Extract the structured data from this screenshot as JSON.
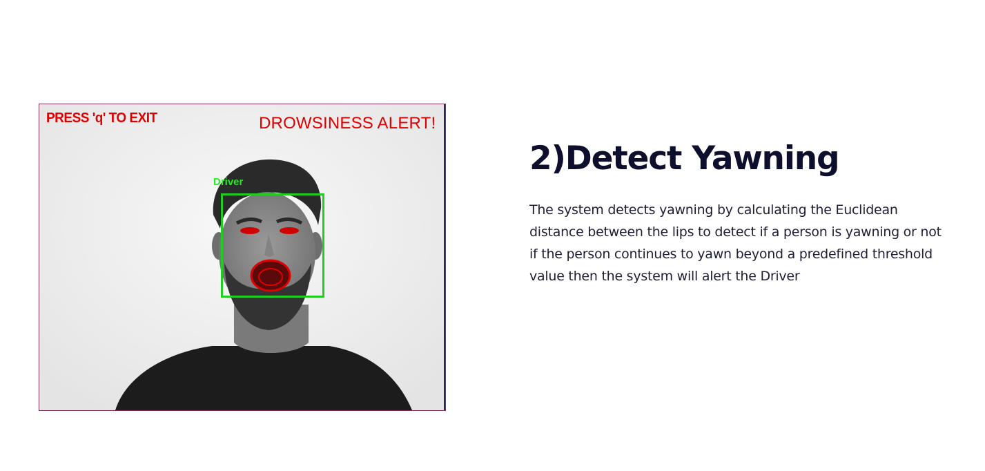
{
  "feature": {
    "heading": "2)Detect Yawning",
    "description": "The system detects yawning by calculating the Euclidean distance between the lips to detect if a person is yawning or not if the person continues to yawn beyond a predefined threshold value then the system will alert the Driver"
  },
  "camera_view": {
    "exit_hint": "PRESS 'q' TO EXIT",
    "alert_text": "DROWSINESS ALERT!",
    "face_label": "Driver",
    "colors": {
      "overlay_text": "#e00000",
      "face_box": "#22cc22",
      "landmarks": "#e00000"
    }
  }
}
